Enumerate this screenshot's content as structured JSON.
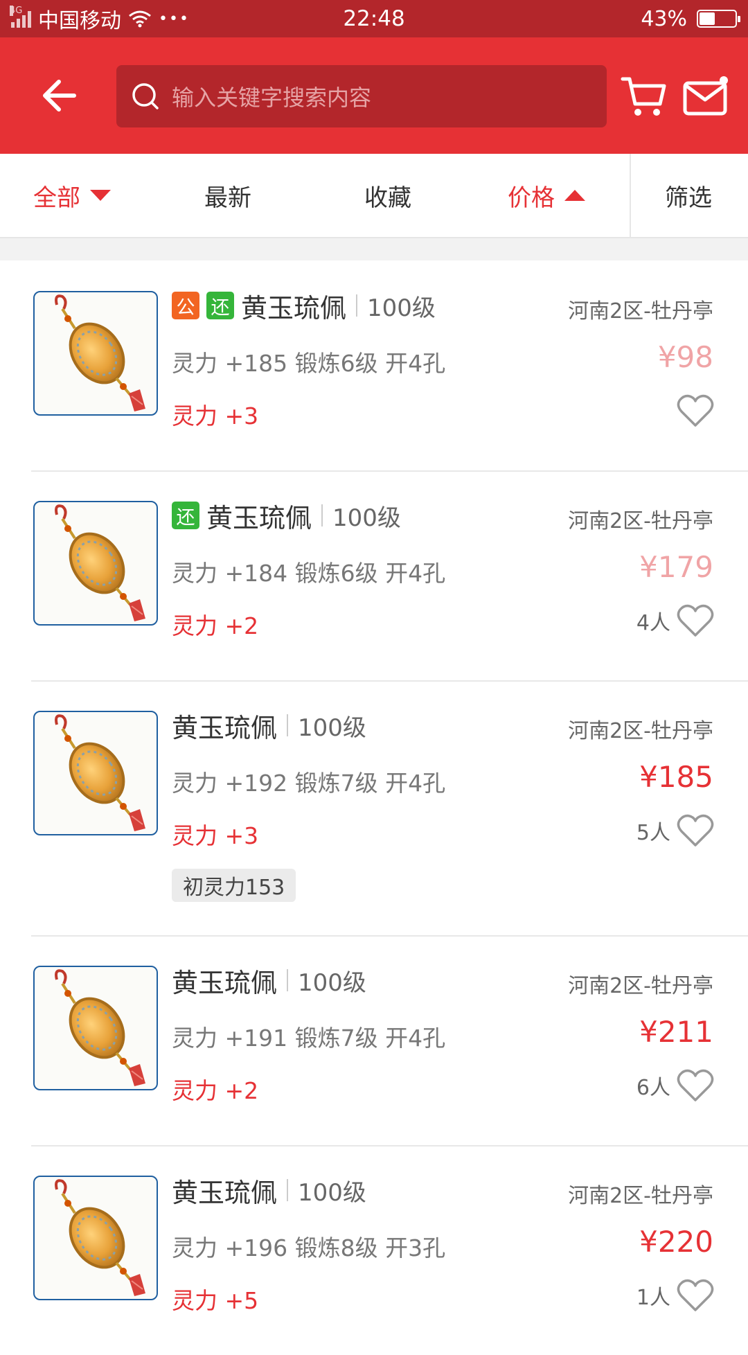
{
  "status_bar": {
    "network": "4G",
    "carrier": "中国移动",
    "dots": "•••",
    "time": "22:48",
    "battery": "43%",
    "battery_level": 0.43
  },
  "header": {
    "search_placeholder": "输入关键字搜索内容"
  },
  "tabs": [
    {
      "label": "全部",
      "active": true,
      "indicator": "down"
    },
    {
      "label": "最新",
      "active": false
    },
    {
      "label": "收藏",
      "active": false
    },
    {
      "label": "价格",
      "active": true,
      "indicator": "up"
    },
    {
      "label": "筛选",
      "active": false
    }
  ],
  "items": [
    {
      "badges": [
        "公",
        "还"
      ],
      "name": "黄玉琉佩",
      "level": "100级",
      "server": "河南2区-牡丹亭",
      "stats": "灵力 +185 锻炼6级 开4孔",
      "bonus": "灵力 +3",
      "price": "¥98",
      "price_faded": true,
      "favorites": "",
      "tag": ""
    },
    {
      "badges": [
        "还"
      ],
      "name": "黄玉琉佩",
      "level": "100级",
      "server": "河南2区-牡丹亭",
      "stats": "灵力 +184 锻炼6级 开4孔",
      "bonus": "灵力 +2",
      "price": "¥179",
      "price_faded": true,
      "favorites": "4人",
      "tag": ""
    },
    {
      "badges": [],
      "name": "黄玉琉佩",
      "level": "100级",
      "server": "河南2区-牡丹亭",
      "stats": "灵力 +192 锻炼7级 开4孔",
      "bonus": "灵力 +3",
      "price": "¥185",
      "price_faded": false,
      "favorites": "5人",
      "tag": "初灵力153"
    },
    {
      "badges": [],
      "name": "黄玉琉佩",
      "level": "100级",
      "server": "河南2区-牡丹亭",
      "stats": "灵力 +191 锻炼7级 开4孔",
      "bonus": "灵力 +2",
      "price": "¥211",
      "price_faded": false,
      "favorites": "6人",
      "tag": ""
    },
    {
      "badges": [],
      "name": "黄玉琉佩",
      "level": "100级",
      "server": "河南2区-牡丹亭",
      "stats": "灵力 +196 锻炼8级 开3孔",
      "bonus": "灵力 +5",
      "price": "¥220",
      "price_faded": false,
      "favorites": "1人",
      "tag": ""
    }
  ],
  "colors": {
    "brand_red": "#e63135",
    "dark_red": "#b3262b",
    "badge_gong": "#f26522",
    "badge_huan": "#35b53a"
  }
}
